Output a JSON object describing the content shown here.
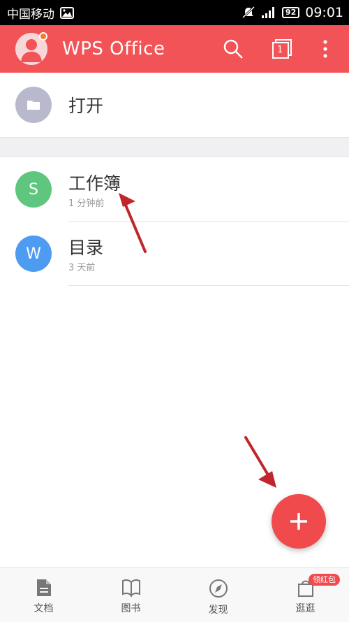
{
  "status_bar": {
    "carrier": "中国移动",
    "battery": "92",
    "time": "09:01"
  },
  "app_bar": {
    "title": "WPS Office",
    "tab_count": "1"
  },
  "open_row": {
    "label": "打开"
  },
  "files": [
    {
      "icon_letter": "S",
      "name": "工作簿",
      "time": "1 分钟前",
      "color": "#5ec67e"
    },
    {
      "icon_letter": "W",
      "name": "目录",
      "time": "3 天前",
      "color": "#4e9bf2"
    }
  ],
  "bottom_nav": {
    "items": [
      {
        "label": "文档"
      },
      {
        "label": "图书"
      },
      {
        "label": "发现"
      },
      {
        "label": "逛逛",
        "badge": "领红包"
      }
    ]
  },
  "colors": {
    "accent": "#f15356",
    "fab": "#f04a4d",
    "folder_icon_bg": "#b9b9cd",
    "annotation_arrow": "#c0262b"
  }
}
